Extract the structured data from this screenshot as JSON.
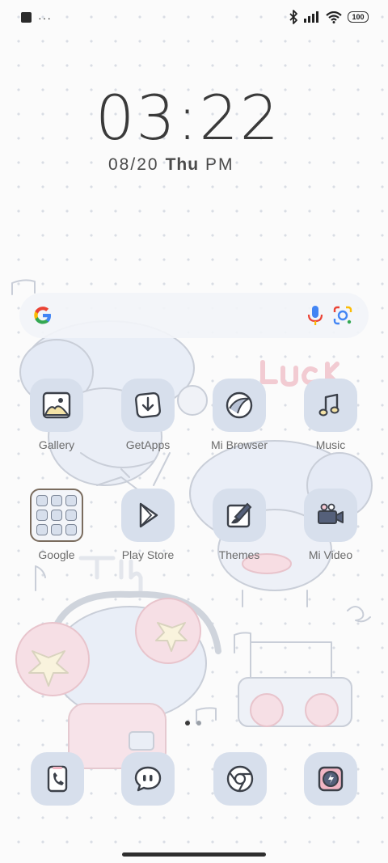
{
  "status_bar": {
    "left_icons": [
      "notification-square-icon",
      "more-dots-icon"
    ],
    "more_text": "···",
    "right_icons": [
      "bluetooth-icon",
      "signal-icon",
      "wifi-icon",
      "battery-icon"
    ],
    "battery_level": "100"
  },
  "clock": {
    "time": "03:22",
    "date": "08/20",
    "weekday": "Thu",
    "ampm": "PM"
  },
  "search": {
    "icons": [
      "google-g-icon",
      "microphone-icon",
      "google-lens-icon"
    ]
  },
  "apps": [
    {
      "label": "Gallery",
      "icon": "gallery-icon"
    },
    {
      "label": "GetApps",
      "icon": "getapps-icon"
    },
    {
      "label": "Mi Browser",
      "icon": "mi-browser-icon"
    },
    {
      "label": "Music",
      "icon": "music-icon"
    },
    {
      "label": "Google",
      "icon": "google-folder-icon"
    },
    {
      "label": "Play Store",
      "icon": "play-store-icon"
    },
    {
      "label": "Themes",
      "icon": "themes-icon"
    },
    {
      "label": "Mi Video",
      "icon": "mi-video-icon"
    }
  ],
  "page_indicator": {
    "pages": 2,
    "active": 0
  },
  "dock": [
    {
      "icon": "phone-icon"
    },
    {
      "icon": "messages-icon"
    },
    {
      "icon": "chrome-icon"
    },
    {
      "icon": "camera-icon"
    }
  ],
  "wallpaper_text": [
    "Luck",
    "Time"
  ],
  "colors": {
    "tile": "#d7dfec",
    "label": "#6b6b6b",
    "clock": "#3a3a3a",
    "outline": "#3b4049"
  }
}
